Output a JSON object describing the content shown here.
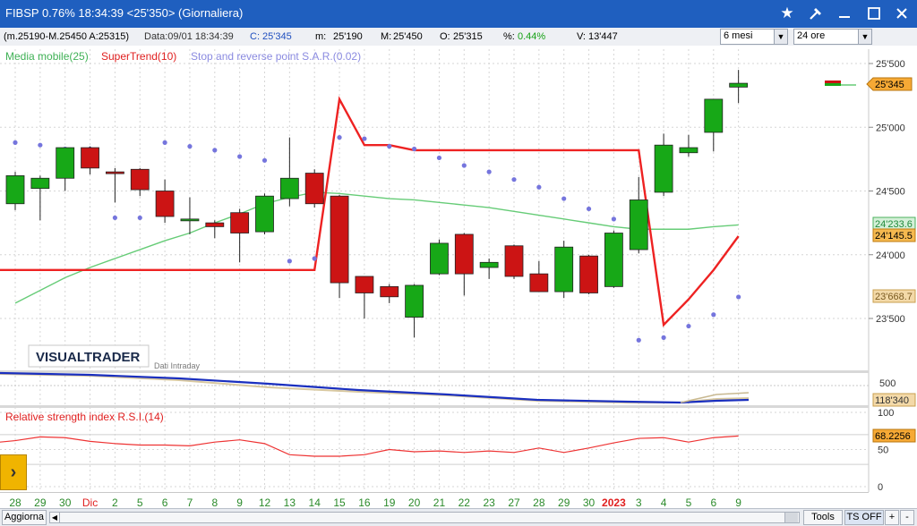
{
  "window": {
    "title": "FIBSP 0.76% 18:34:39  <25'350> (Giornaliera)",
    "icons": [
      "star-icon",
      "tools-icon",
      "minimize-icon",
      "maximize-icon",
      "close-icon"
    ]
  },
  "infobar": {
    "range": "(m.25190-M.25450 A:25315)",
    "data": "Data:09/01 18:34:39",
    "close_label": "C:",
    "close_value": "25'345",
    "min_label": "m:",
    "min_value": "25'190",
    "max_label": "M:",
    "max_value": "25'450",
    "open_label": "O:",
    "open_value": "25'315",
    "pct_label": "%:",
    "pct_value": "0.44%",
    "vol_label": "V:",
    "vol_value": "13'447",
    "period_select": "6 mesi",
    "timeframe_select": "24 ore"
  },
  "legend": {
    "ma": "Media mobile(25)",
    "supertrend": "SuperTrend(10)",
    "sar": "Stop and reverse point S.A.R.(0.02)"
  },
  "brand": "VISUALTRADER",
  "intraday_label": "Dati Intraday",
  "rsi_label": "Relative strength index R.S.I.(14)",
  "price_ticks": [
    "25'500",
    "25'000",
    "24'500",
    "24'000",
    "23'500"
  ],
  "price_tags": {
    "last": "25'345",
    "ma": "24'233.6",
    "supertrend": "24'145.5",
    "sar": "23'668.7"
  },
  "volume_tags": {
    "top": "500",
    "value": "118'340"
  },
  "rsi_ticks": [
    "100",
    "50",
    "0"
  ],
  "rsi_tag": "68.2256",
  "x_labels": [
    "28",
    "29",
    "30",
    "Dic",
    "2",
    "5",
    "6",
    "7",
    "8",
    "9",
    "12",
    "13",
    "14",
    "15",
    "16",
    "19",
    "20",
    "21",
    "22",
    "23",
    "27",
    "28",
    "29",
    "30",
    "2023",
    "3",
    "4",
    "5",
    "6",
    "9"
  ],
  "bottombar": {
    "refresh": "Aggiorna",
    "tools": "Tools",
    "ts": "TS OFF",
    "plus": "+",
    "minus": "-"
  },
  "colors": {
    "up": "#17a817",
    "down": "#cc1414",
    "supertrend": "#ee2222",
    "ma": "#66cc77",
    "sar": "#7575dd",
    "title": "#1f5fbf"
  },
  "chart_data": {
    "type": "candlestick",
    "y_range": [
      23300,
      25600
    ],
    "candles": [
      {
        "label": "28",
        "open": 24400,
        "high": 24650,
        "low": 24350,
        "close": 24620
      },
      {
        "label": "29",
        "open": 24520,
        "high": 24620,
        "low": 24270,
        "close": 24600
      },
      {
        "label": "30",
        "open": 24600,
        "high": 24840,
        "low": 24500,
        "close": 24840
      },
      {
        "label": "Dic",
        "open": 24840,
        "high": 24850,
        "low": 24630,
        "close": 24680
      },
      {
        "label": "2",
        "open": 24650,
        "high": 24680,
        "low": 24410,
        "close": 24640
      },
      {
        "label": "5",
        "open": 24670,
        "high": 24680,
        "low": 24460,
        "close": 24510
      },
      {
        "label": "6",
        "open": 24500,
        "high": 24590,
        "low": 24250,
        "close": 24300
      },
      {
        "label": "7",
        "open": 24280,
        "high": 24450,
        "low": 24160,
        "close": 24280
      },
      {
        "label": "8",
        "open": 24250,
        "high": 24270,
        "low": 24130,
        "close": 24220
      },
      {
        "label": "9",
        "open": 24330,
        "high": 24360,
        "low": 23940,
        "close": 24170
      },
      {
        "label": "12",
        "open": 24180,
        "high": 24480,
        "low": 24160,
        "close": 24460
      },
      {
        "label": "13",
        "open": 24440,
        "high": 24920,
        "low": 24380,
        "close": 24600
      },
      {
        "label": "14",
        "open": 24640,
        "high": 24670,
        "low": 24370,
        "close": 24400
      },
      {
        "label": "15",
        "open": 24460,
        "high": 24470,
        "low": 23660,
        "close": 23780
      },
      {
        "label": "16",
        "open": 23830,
        "high": 23830,
        "low": 23500,
        "close": 23700
      },
      {
        "label": "19",
        "open": 23750,
        "high": 23770,
        "low": 23620,
        "close": 23670
      },
      {
        "label": "20",
        "open": 23510,
        "high": 23770,
        "low": 23350,
        "close": 23760
      },
      {
        "label": "21",
        "open": 23850,
        "high": 24120,
        "low": 23840,
        "close": 24090
      },
      {
        "label": "22",
        "open": 24160,
        "high": 24170,
        "low": 23680,
        "close": 23850
      },
      {
        "label": "23",
        "open": 23900,
        "high": 23970,
        "low": 23810,
        "close": 23940
      },
      {
        "label": "27",
        "open": 24070,
        "high": 24080,
        "low": 23810,
        "close": 23830
      },
      {
        "label": "28",
        "open": 23850,
        "high": 23950,
        "low": 23710,
        "close": 23710
      },
      {
        "label": "29",
        "open": 23710,
        "high": 24110,
        "low": 23660,
        "close": 24060
      },
      {
        "label": "30",
        "open": 23990,
        "high": 24000,
        "low": 23690,
        "close": 23700
      },
      {
        "label": "2023",
        "open": 23750,
        "high": 24190,
        "low": 23740,
        "close": 24170
      },
      {
        "label": "3",
        "open": 24040,
        "high": 24610,
        "low": 24010,
        "close": 24430
      },
      {
        "label": "4",
        "open": 24490,
        "high": 24950,
        "low": 24460,
        "close": 24860
      },
      {
        "label": "5",
        "open": 24800,
        "high": 24940,
        "low": 24770,
        "close": 24840
      },
      {
        "label": "6",
        "open": 24960,
        "high": 25220,
        "low": 24810,
        "close": 25220
      },
      {
        "label": "9",
        "open": 25315,
        "high": 25450,
        "low": 25190,
        "close": 25345
      }
    ],
    "supertrend": [
      23880,
      23880,
      23880,
      23880,
      23880,
      23880,
      23880,
      23880,
      23880,
      23880,
      23880,
      23880,
      23880,
      25220,
      24860,
      24860,
      24820,
      24820,
      24820,
      24820,
      24820,
      24820,
      24820,
      24820,
      24820,
      24820,
      23450,
      23650,
      23880,
      24145.5
    ],
    "moving_average": [
      23620,
      23720,
      23820,
      23900,
      23970,
      24040,
      24110,
      24170,
      24250,
      24320,
      24400,
      24450,
      24490,
      24480,
      24460,
      24440,
      24430,
      24410,
      24390,
      24370,
      24340,
      24310,
      24280,
      24250,
      24220,
      24200,
      24200,
      24200,
      24220,
      24233.6
    ],
    "sar": [
      24880,
      24860,
      24830,
      24830,
      24290,
      24290,
      24880,
      24850,
      24820,
      24770,
      24740,
      23950,
      23970,
      24920,
      24910,
      24850,
      24830,
      24760,
      24700,
      24650,
      24590,
      24530,
      24440,
      24360,
      24280,
      23330,
      23350,
      23440,
      23530,
      23668.7
    ],
    "rsi": [
      62,
      67,
      66,
      61,
      58,
      56,
      56,
      55,
      60,
      63,
      58,
      43,
      41,
      41,
      43,
      50,
      47,
      48,
      46,
      48,
      46,
      52,
      46,
      52,
      59,
      65,
      66,
      60,
      66,
      68.2
    ]
  }
}
